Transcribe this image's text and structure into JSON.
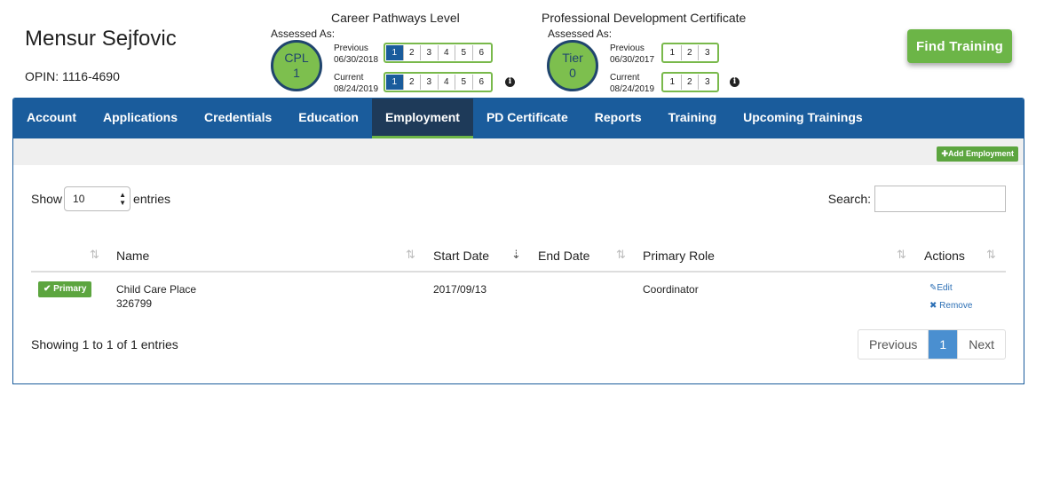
{
  "user": {
    "name": "Mensur Sejfovic",
    "opin": "OPIN: 1116-4690"
  },
  "career_pathways": {
    "title": "Career Pathways Level",
    "assessed_label": "Assessed As:",
    "badge_line1": "CPL",
    "badge_line2": "1",
    "previous_label": "Previous",
    "previous_date": "06/30/2018",
    "current_label": "Current",
    "current_date": "08/24/2019",
    "levels": [
      "1",
      "2",
      "3",
      "4",
      "5",
      "6"
    ],
    "previous_selected": 1,
    "current_selected": 1
  },
  "pd_certificate": {
    "title": "Professional Development Certificate",
    "assessed_label": "Assessed As:",
    "badge_line1": "Tier",
    "badge_line2": "0",
    "previous_label": "Previous",
    "previous_date": "06/30/2017",
    "current_label": "Current",
    "current_date": "08/24/2019",
    "levels": [
      "1",
      "2",
      "3"
    ]
  },
  "find_training_label": "Find Training",
  "nav": {
    "items": [
      "Account",
      "Applications",
      "Credentials",
      "Education",
      "Employment",
      "PD Certificate",
      "Reports",
      "Training",
      "Upcoming Trainings"
    ],
    "active": "Employment"
  },
  "toolbar": {
    "add_employment_label": "Add Employment"
  },
  "table_controls": {
    "show_label": "Show",
    "entries_value": "10",
    "entries_label": "entries",
    "search_label": "Search:",
    "search_value": ""
  },
  "table": {
    "columns": [
      "Name",
      "Start Date",
      "End Date",
      "Primary Role",
      "Actions"
    ],
    "rows": [
      {
        "badge": "Primary",
        "name": "Child Care Place",
        "id": "326799",
        "start_date": "2017/09/13",
        "end_date": "",
        "primary_role": "Coordinator",
        "edit_label": "Edit",
        "remove_label": "Remove"
      }
    ]
  },
  "footer": {
    "info": "Showing 1 to 1 of 1 entries",
    "previous_label": "Previous",
    "page": "1",
    "next_label": "Next"
  },
  "colors": {
    "nav_blue": "#1a5c9c",
    "nav_active": "#1e3a59",
    "accent_green": "#6cb547",
    "pager_active": "#4a8fd0"
  }
}
